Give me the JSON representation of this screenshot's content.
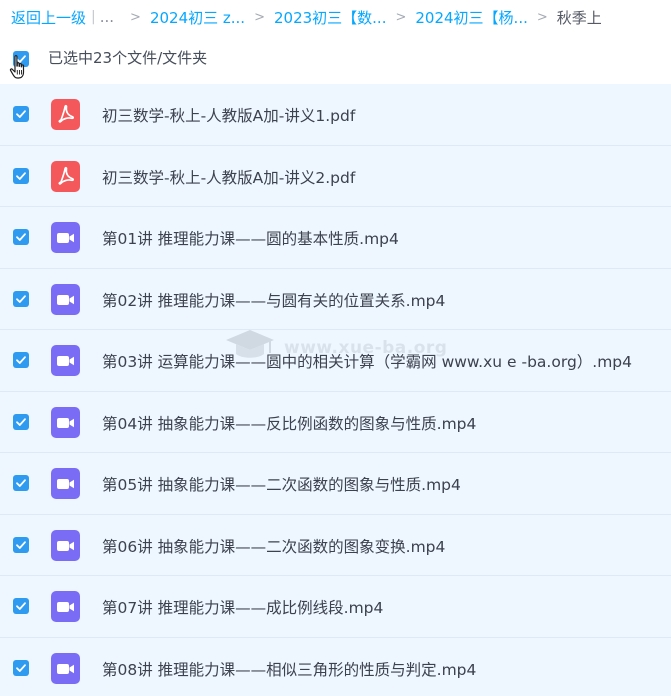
{
  "breadcrumb": {
    "back_label": "返回上一级",
    "pipe": "|",
    "ellipsis": "...",
    "separator": ">",
    "crumbs": [
      {
        "label": "2024初三 z..."
      },
      {
        "label": "2023初三【数..."
      },
      {
        "label": "2024初三【杨..."
      }
    ],
    "current": "秋季上"
  },
  "selection": {
    "label": "已选中23个文件/文件夹",
    "checked": true
  },
  "colors": {
    "accent": "#06a7ff",
    "checkbox": "#2e9bf0",
    "row_bg": "#eef6ff",
    "pdf_icon": "#f5585a",
    "video_icon": "#7b6cf6"
  },
  "files": [
    {
      "name": "初三数学-秋上-人教版A加-讲义1.pdf",
      "icon": "pdf-icon",
      "checked": true
    },
    {
      "name": "初三数学-秋上-人教版A加-讲义2.pdf",
      "icon": "pdf-icon",
      "checked": true
    },
    {
      "name": "第01讲 推理能力课——圆的基本性质.mp4",
      "icon": "video-icon",
      "checked": true
    },
    {
      "name": "第02讲 推理能力课——与圆有关的位置关系.mp4",
      "icon": "video-icon",
      "checked": true
    },
    {
      "name": "第03讲 运算能力课——圆中的相关计算（学霸网 www.xu e -ba.org）.mp4",
      "icon": "video-icon",
      "checked": true
    },
    {
      "name": "第04讲 抽象能力课——反比例函数的图象与性质.mp4",
      "icon": "video-icon",
      "checked": true
    },
    {
      "name": "第05讲 抽象能力课——二次函数的图象与性质.mp4",
      "icon": "video-icon",
      "checked": true
    },
    {
      "name": "第06讲 抽象能力课——二次函数的图象变换.mp4",
      "icon": "video-icon",
      "checked": true
    },
    {
      "name": "第07讲 推理能力课——成比例线段.mp4",
      "icon": "video-icon",
      "checked": true
    },
    {
      "name": "第08讲 推理能力课——相似三角形的性质与判定.mp4",
      "icon": "video-icon",
      "checked": true
    }
  ],
  "watermark": "www.xue-ba.org"
}
